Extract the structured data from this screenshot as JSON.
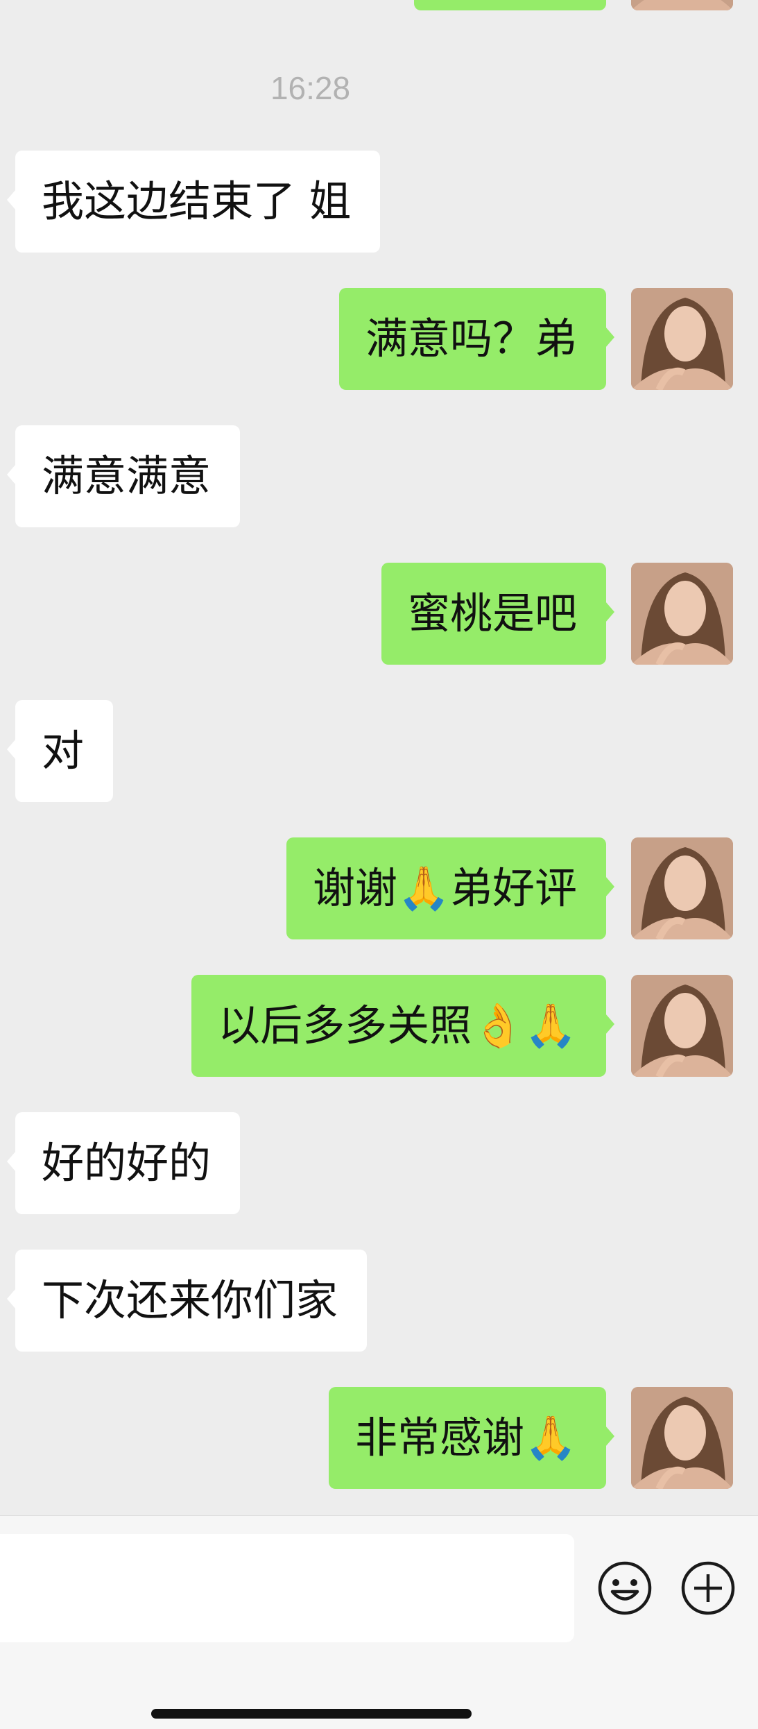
{
  "chat": {
    "timestamp": "16:28",
    "messages": [
      {
        "side": "in",
        "text": "我这边结束了 姐"
      },
      {
        "side": "out",
        "text": "满意吗？弟"
      },
      {
        "side": "in",
        "text": "满意满意"
      },
      {
        "side": "out",
        "text": "蜜桃是吧"
      },
      {
        "side": "in",
        "text": "对"
      },
      {
        "side": "out",
        "text": "谢谢🙏弟好评"
      },
      {
        "side": "out",
        "text": "以后多多关照👌🙏"
      },
      {
        "side": "in",
        "text": "好的好的"
      },
      {
        "side": "in",
        "text": "下次还来你们家"
      },
      {
        "side": "out",
        "text": "非常感谢🙏"
      }
    ]
  },
  "input": {
    "value": "",
    "placeholder": ""
  },
  "icons": {
    "emoji": "emoji-smile-icon",
    "more": "plus-circle-icon"
  },
  "colors": {
    "background": "#ededed",
    "incoming_bubble": "#ffffff",
    "outgoing_bubble": "#95ec69",
    "timestamp": "#b2b2b2"
  }
}
